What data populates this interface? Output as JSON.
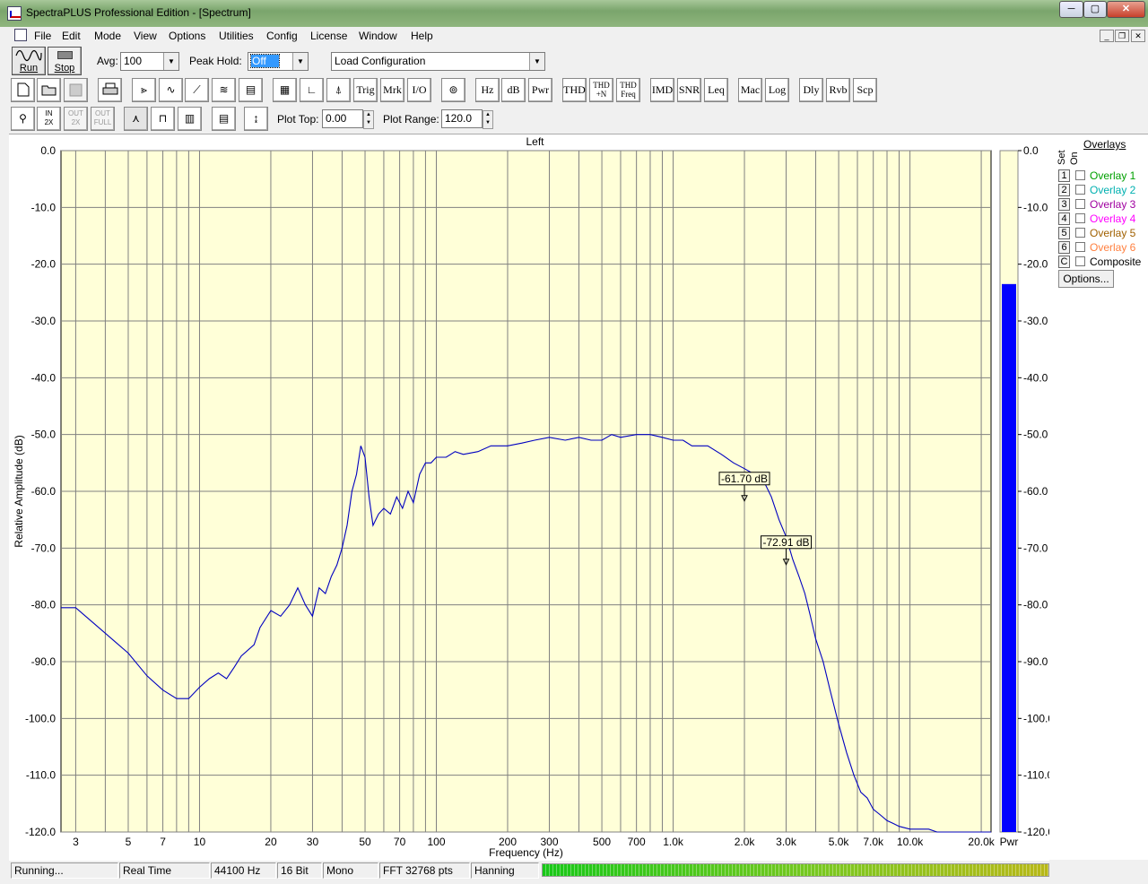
{
  "window": {
    "title": "SpectraPLUS Professional Edition - [Spectrum]"
  },
  "caption": {
    "min": "─",
    "max": "▢",
    "close": "✕"
  },
  "menu": [
    "File",
    "Edit",
    "Mode",
    "View",
    "Options",
    "Utilities",
    "Config",
    "License",
    "Window",
    "Help"
  ],
  "mdi": {
    "min": "_",
    "restore": "❐",
    "close": "✕"
  },
  "toolbar1": {
    "run": "Run",
    "stop": "Stop",
    "avg_label": "Avg:",
    "avg_value": "100",
    "peak_label": "Peak Hold:",
    "peak_value": "Off",
    "config_value": "Load Configuration"
  },
  "toolbar2": {
    "trig": "Trig",
    "mrk": "Mrk",
    "io": "I/O",
    "hz": "Hz",
    "db": "dB",
    "pwr": "Pwr",
    "thd": "THD",
    "thdn_1": "THD",
    "thdn_2": "+N",
    "thdf_1": "THD",
    "thdf_2": "Freq",
    "imd": "IMD",
    "snr": "SNR",
    "leq": "Leq",
    "mac": "Mac",
    "log": "Log",
    "dly": "Dly",
    "rvb": "Rvb",
    "scp": "Scp"
  },
  "toolbar3": {
    "zoom_in_1": "IN",
    "zoom_in_2": "2X",
    "zoom_out_1": "OUT",
    "zoom_out_2": "2X",
    "zoom_full_1": "OUT",
    "zoom_full_2": "FULL",
    "plot_top_label": "Plot Top:",
    "plot_top_value": "0.00",
    "plot_range_label": "Plot Range:",
    "plot_range_value": "120.0"
  },
  "plot": {
    "channel": "Left",
    "power_label": "Pwr",
    "marker1": "-61.70 dB",
    "marker2": "-72.91 dB",
    "colors": {
      "bg": "#ffffd8",
      "trace": "#0000c0",
      "grid": "#808080",
      "power": "#0000ff"
    }
  },
  "overlays": {
    "title": "Overlays",
    "set_label": "Set",
    "on_label": "On",
    "items": [
      {
        "key": "1",
        "label": "Overlay 1",
        "color": "#00a000"
      },
      {
        "key": "2",
        "label": "Overlay 2",
        "color": "#00b0b0"
      },
      {
        "key": "3",
        "label": "Overlay 3",
        "color": "#a000a0"
      },
      {
        "key": "4",
        "label": "Overlay 4",
        "color": "#ff00ff"
      },
      {
        "key": "5",
        "label": "Overlay 5",
        "color": "#a06000"
      },
      {
        "key": "6",
        "label": "Overlay 6",
        "color": "#ff8040"
      },
      {
        "key": "C",
        "label": "Composite",
        "color": "#000000"
      }
    ],
    "options": "Options..."
  },
  "status": {
    "state": "Running...",
    "mode": "Real Time",
    "rate": "44100 Hz",
    "bits": "16 Bit",
    "channels": "Mono",
    "fft": "FFT 32768 pts",
    "window": "Hanning"
  },
  "chart_data": {
    "type": "line",
    "xlabel": "Frequency (Hz)",
    "ylabel": "Relative Amplitude (dB)",
    "title": "Left",
    "x_scale": "log",
    "xlim": [
      2.6,
      22000
    ],
    "ylim": [
      -120,
      0
    ],
    "grid": true,
    "y_ticks": [
      "0.0",
      "-10.0",
      "-20.0",
      "-30.0",
      "-40.0",
      "-50.0",
      "-60.0",
      "-70.0",
      "-80.0",
      "-90.0",
      "-100.0",
      "-110.0",
      "-120.0"
    ],
    "x_tick_labels": [
      "3",
      "5",
      "7",
      "10",
      "20",
      "30",
      "50",
      "70",
      "100",
      "200",
      "300",
      "500",
      "700",
      "1.0k",
      "2.0k",
      "3.0k",
      "5.0k",
      "7.0k",
      "10.0k",
      "20.0k"
    ],
    "x_tick_values": [
      3,
      5,
      7,
      10,
      20,
      30,
      50,
      70,
      100,
      200,
      300,
      500,
      700,
      1000,
      2000,
      3000,
      5000,
      7000,
      10000,
      20000
    ],
    "series": [
      {
        "x": [
          2.6,
          3,
          4,
          5,
          6,
          7,
          8,
          9,
          10,
          11,
          12,
          13,
          14,
          15,
          17,
          18,
          20,
          22,
          24,
          26,
          28,
          30,
          32,
          34,
          36,
          38,
          40,
          42,
          44,
          46,
          48,
          50,
          52,
          54,
          57,
          60,
          64,
          68,
          72,
          76,
          80,
          85,
          90,
          95,
          100,
          110,
          120,
          130,
          150,
          170,
          200,
          230,
          260,
          300,
          350,
          400,
          450,
          500,
          550,
          600,
          700,
          800,
          900,
          1000,
          1100,
          1200,
          1400,
          1600,
          1800,
          2000,
          2200,
          2400,
          2600,
          2800,
          3000,
          3200,
          3400,
          3600,
          3800,
          4000,
          4300,
          4600,
          5000,
          5400,
          5800,
          6200,
          6600,
          7000,
          7500,
          8000,
          8500,
          9000,
          10000,
          11000,
          12000,
          13000,
          14000,
          15000,
          16000,
          17000,
          18000,
          19000,
          20000,
          21000,
          22000
        ],
        "y": [
          -80.5,
          -80.5,
          -85,
          -88.5,
          -92.5,
          -95,
          -96.5,
          -96.5,
          -94.5,
          -93,
          -92,
          -93,
          -91,
          -89,
          -87,
          -84,
          -81,
          -82,
          -80,
          -77,
          -80,
          -82,
          -77,
          -78,
          -75,
          -73,
          -70,
          -66,
          -60,
          -57,
          -52,
          -54,
          -61,
          -66,
          -64,
          -63,
          -64,
          -61,
          -63,
          -60,
          -62,
          -57,
          -55,
          -55,
          -54,
          -54,
          -53,
          -53.5,
          -53,
          -52,
          -52,
          -51.5,
          -51,
          -50.5,
          -51,
          -50.5,
          -51,
          -51,
          -50,
          -50.5,
          -50,
          -50,
          -50.5,
          -51,
          -51,
          -52,
          -52,
          -53.5,
          -55,
          -56,
          -57,
          -58,
          -61,
          -65,
          -68,
          -72,
          -75,
          -78,
          -82,
          -86,
          -90,
          -95,
          -101,
          -106,
          -110,
          -113,
          -114,
          -116,
          -117,
          -118,
          -118.5,
          -119,
          -119.5,
          -119.5,
          -119.5,
          -120,
          -120,
          -120,
          -120,
          -120,
          -120,
          -120,
          -120,
          -120,
          -120
        ]
      }
    ],
    "power_level_db": -23.5
  }
}
